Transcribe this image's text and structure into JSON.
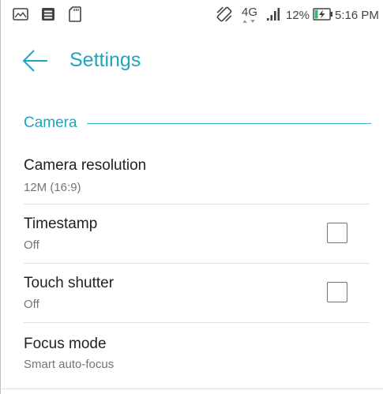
{
  "status_bar": {
    "icons": [
      "gallery-icon",
      "message-icon",
      "sd-card-icon",
      "vibrate-icon",
      "signal-icon",
      "battery-charging-icon"
    ],
    "network": "4G",
    "battery": "12%",
    "time": "5:16 PM"
  },
  "app_bar": {
    "back_icon": "arrow-left-icon",
    "title": "Settings"
  },
  "section": {
    "title": "Camera"
  },
  "settings": [
    {
      "title": "Camera resolution",
      "value": "12M (16:9)"
    },
    {
      "title": "Timestamp",
      "value": "Off",
      "checked": false
    },
    {
      "title": "Touch shutter",
      "value": "Off",
      "checked": false
    },
    {
      "title": "Focus mode",
      "value": "Smart auto-focus"
    }
  ],
  "colors": {
    "accent": "#1ea5c0",
    "title_text": "#212121",
    "subtitle_text": "#757575"
  }
}
